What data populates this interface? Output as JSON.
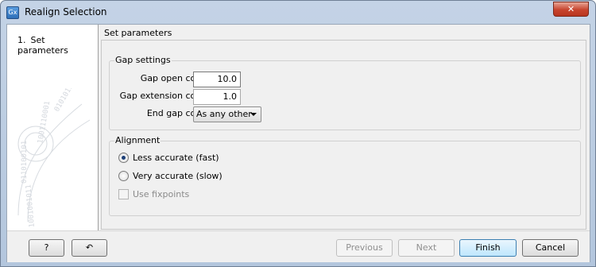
{
  "window": {
    "title": "Realign Selection",
    "icon_text": "Gx",
    "close_symbol": "✕"
  },
  "sidebar": {
    "steps": [
      {
        "number": "1.",
        "label": "Set parameters"
      }
    ]
  },
  "main": {
    "heading": "Set parameters"
  },
  "gap_settings": {
    "title": "Gap settings",
    "gap_open_label": "Gap open cost:",
    "gap_open_value": "10.0",
    "gap_extension_label": "Gap extension cost:",
    "gap_extension_value": "1.0",
    "end_gap_label": "End gap cost:",
    "end_gap_value": "As any other"
  },
  "alignment": {
    "title": "Alignment",
    "option_fast": "Less accurate (fast)",
    "option_slow": "Very accurate (slow)",
    "fixpoints_label": "Use fixpoints",
    "selected": "Less accurate (fast)"
  },
  "buttons": {
    "help": "?",
    "reset": "↶",
    "previous": "Previous",
    "next": "Next",
    "finish": "Finish",
    "cancel": "Cancel"
  },
  "colors": {
    "title_bar": "#c4d3e6",
    "close_button": "#c7442e",
    "primary_button": "#bee6fd"
  }
}
